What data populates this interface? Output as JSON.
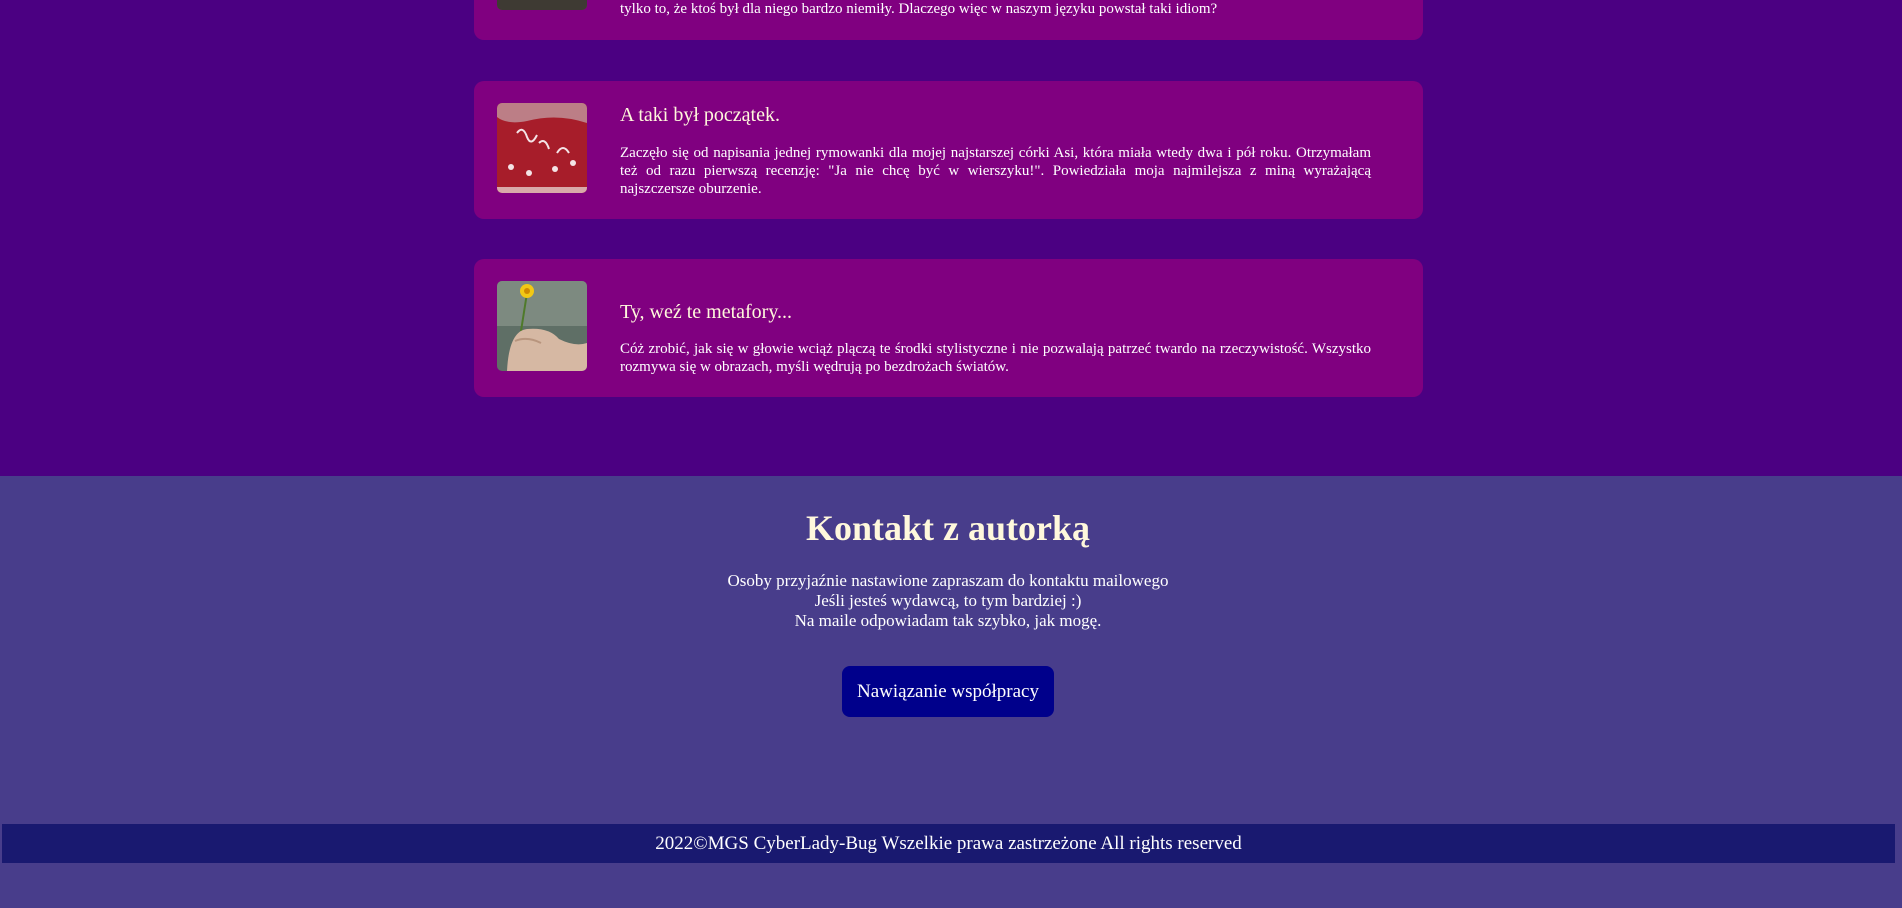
{
  "posts": [
    {
      "title": "",
      "text": "tylko to, że ktoś był dla niego bardzo niemiły. Dlaczego więc w naszym języku powstał taki idiom?",
      "thumb_icon": "photo-thumbnail-icon"
    },
    {
      "title": "A taki był początek.",
      "text": "Zaczęło się od napisania jednej rymowanki dla mojej najstarszej córki Asi, która miała wtedy dwa i pół roku. Otrzymałam też od razu pierwszą recenzję: \"Ja nie chcę być w wierszyku!\". Powiedziała moja najmilejsza z miną wyrażającą najszczersze oburzenie.",
      "thumb_icon": "red-cake-icon"
    },
    {
      "title": "Ty, weź te metafory...",
      "text": "Cóż zrobić, jak się w głowie wciąż plączą te środki stylistyczne i nie pozwalają patrzeć twardo na rzeczywistość. Wszystko rozmywa się w obrazach, myśli wędrują po bezdrożach światów.",
      "thumb_icon": "hand-flower-icon"
    }
  ],
  "contact": {
    "title": "Kontakt z autorką",
    "lines": [
      "Osoby przyjaźnie nastawione zapraszam do kontaktu mailowego",
      "Jeśli jesteś wydawcą, to tym bardziej :)",
      "Na maile odpowiadam tak szybko, jak mogę."
    ],
    "button_label": "Nawiązanie współpracy"
  },
  "footer": {
    "text": "2022©MGS CyberLady-Bug Wszelkie prawa zastrzeżone All rights reserved"
  },
  "colors": {
    "page_bg": "#4b0082",
    "card_bg": "#800080",
    "contact_bg": "#483d8b",
    "button_bg": "#00008b",
    "footer_bg": "#191970",
    "heading": "#fff8dc"
  }
}
